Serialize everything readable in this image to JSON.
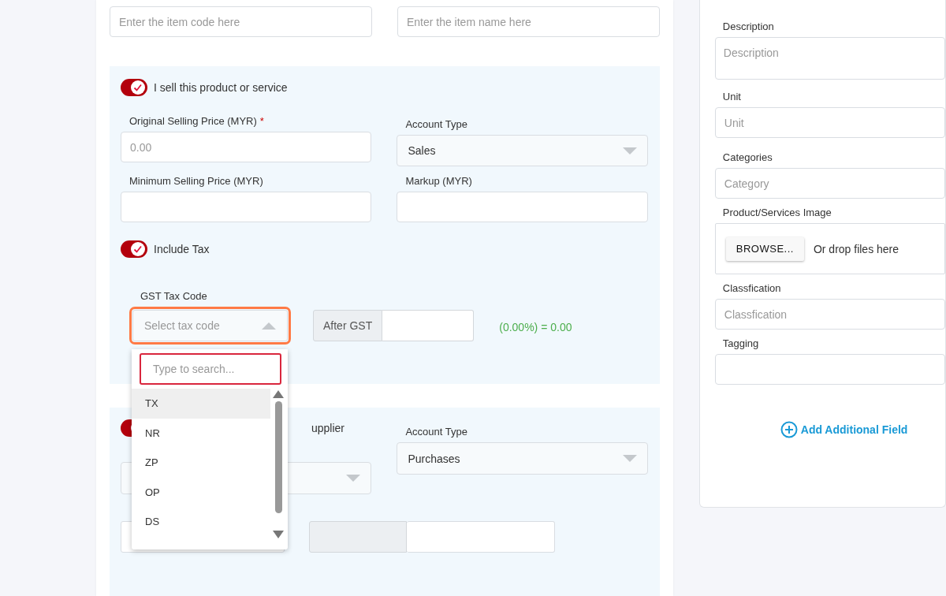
{
  "item_fields": [
    {
      "placeholder": "Enter the item code here"
    },
    {
      "placeholder": "Enter the item name here"
    }
  ],
  "sell_section": {
    "toggle": {
      "label": "I sell this product or service",
      "on": true
    },
    "fields": [
      {
        "kind": "input",
        "label": "Original Selling Price (MYR)",
        "required_mark": "*",
        "placeholder": "0.00"
      },
      {
        "kind": "select",
        "label": "Account Type",
        "value": "Sales"
      },
      {
        "kind": "input",
        "label": "Minimum Selling Price (MYR)"
      },
      {
        "kind": "input",
        "label": "Markup (MYR)"
      }
    ],
    "tax_toggle": {
      "label": "Include Tax",
      "on": true
    },
    "gst": {
      "label": "GST Tax Code",
      "placeholder": "Select tax code",
      "expanded": true,
      "addon": "After GST",
      "result": "(0.00%) = 0.00"
    }
  },
  "tax_dropdown": {
    "search_placeholder": "Type to search...",
    "options": [
      {
        "label": "TX",
        "selected": true
      },
      {
        "label": "NR",
        "selected": false
      },
      {
        "label": "ZP",
        "selected": false
      },
      {
        "label": "OP",
        "selected": false
      },
      {
        "label": "DS",
        "selected": false
      }
    ]
  },
  "purchase_section": {
    "toggle": {
      "label": "upplier",
      "on": true
    },
    "fields": [
      {
        "kind": "select"
      },
      {
        "kind": "select",
        "label": "Account Type",
        "value": "Purchases"
      }
    ]
  },
  "side_panel": {
    "fields": [
      {
        "kind": "textarea",
        "label": "Description",
        "placeholder": "Description"
      },
      {
        "kind": "input",
        "label": "Unit",
        "placeholder": "Unit"
      },
      {
        "kind": "input",
        "label": "Categories",
        "placeholder": "Category"
      },
      {
        "kind": "file",
        "label": "Product/Services Image",
        "button": "BROWSE...",
        "hint": "Or drop files here"
      },
      {
        "kind": "input",
        "label": "Classfication",
        "placeholder": "Classfication"
      },
      {
        "kind": "input",
        "label": "Tagging"
      }
    ],
    "add_field": "Add Additional Field"
  }
}
